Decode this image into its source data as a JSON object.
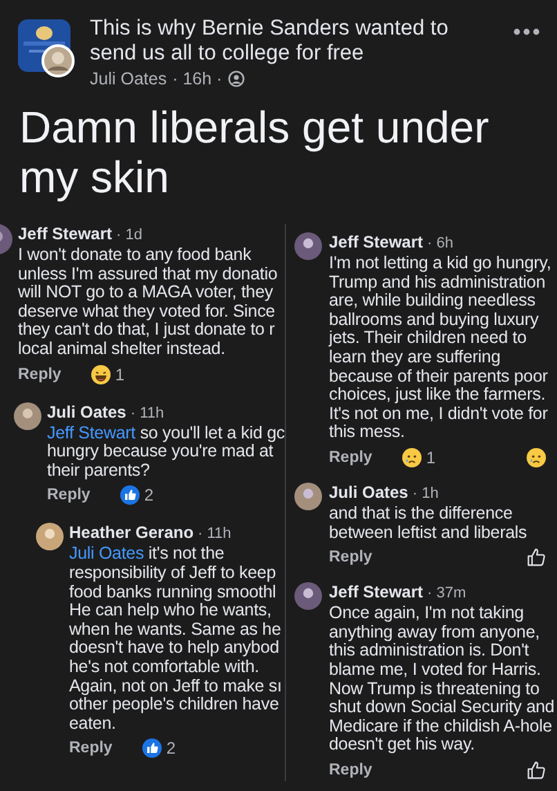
{
  "post": {
    "title": "This is why Bernie Sanders wanted to send us all to college for free",
    "author": "Juli Oates",
    "time": "· 16h ·",
    "text": "Damn liberals get under my skin"
  },
  "left_thread": [
    {
      "author": "Jeff Stewart",
      "time": "· 1d",
      "lines": [
        "I won't donate to any food bank",
        "unless I'm assured that my donatio",
        "will NOT go to a MAGA voter, they",
        "deserve what they voted for. Since",
        "they can't do that, I just donate to r",
        "local animal shelter instead."
      ],
      "reply": "Reply",
      "reaction": {
        "kind": "haha",
        "count": "1"
      },
      "children": [
        {
          "author": "Juli Oates",
          "time": "· 11h",
          "mention": "Jeff Stewart",
          "lines": [
            "so you'll let a kid gc",
            "hungry because you're mad at",
            "their parents?"
          ],
          "reply": "Reply",
          "reaction": {
            "kind": "like",
            "count": "2"
          },
          "children": [
            {
              "author": "Heather Gerano",
              "time": "· 11h",
              "mention": "Juli Oates",
              "lines": [
                "it's not the",
                "responsibility of Jeff to keep",
                "food banks running smoothl",
                "He can help who he wants,",
                "when he wants. Same as he",
                "doesn't have to help anybod",
                "he's not comfortable with.",
                "Again, not on Jeff to make sı",
                "other people's children have",
                "eaten."
              ],
              "reply": "Reply",
              "reaction": {
                "kind": "like",
                "count": "2"
              }
            }
          ]
        }
      ]
    }
  ],
  "right_thread": [
    {
      "author": "Jeff Stewart",
      "time": "· 6h",
      "lines": [
        "I'm not letting a kid go hungry,",
        "Trump and his administration",
        "are, while building needless",
        "ballrooms and buying luxury",
        "jets. Their children need to",
        "learn they are suffering",
        "because of their parents poor",
        "choices, just like the farmers.",
        "It's not on me, I didn't vote for",
        "this mess."
      ],
      "reply": "Reply",
      "reaction": {
        "kind": "sad",
        "count": "1"
      },
      "side_button": {
        "kind": "sad"
      }
    },
    {
      "author": "Juli Oates",
      "time": "· 1h",
      "lines": [
        "and that is the difference",
        "between leftist and liberals"
      ],
      "reply": "Reply",
      "side_button": {
        "kind": "outline"
      }
    },
    {
      "author": "Jeff Stewart",
      "time": "· 37m",
      "lines": [
        "Once again, I'm not taking",
        "anything away from anyone,",
        "this administration is. Don't",
        "blame me, I voted for Harris.",
        "Now Trump is threatening to",
        "shut down Social Security and",
        "Medicare if the childish A-hole",
        "doesn't get his way."
      ],
      "reply": "Reply",
      "side_button": {
        "kind": "outline"
      }
    }
  ]
}
